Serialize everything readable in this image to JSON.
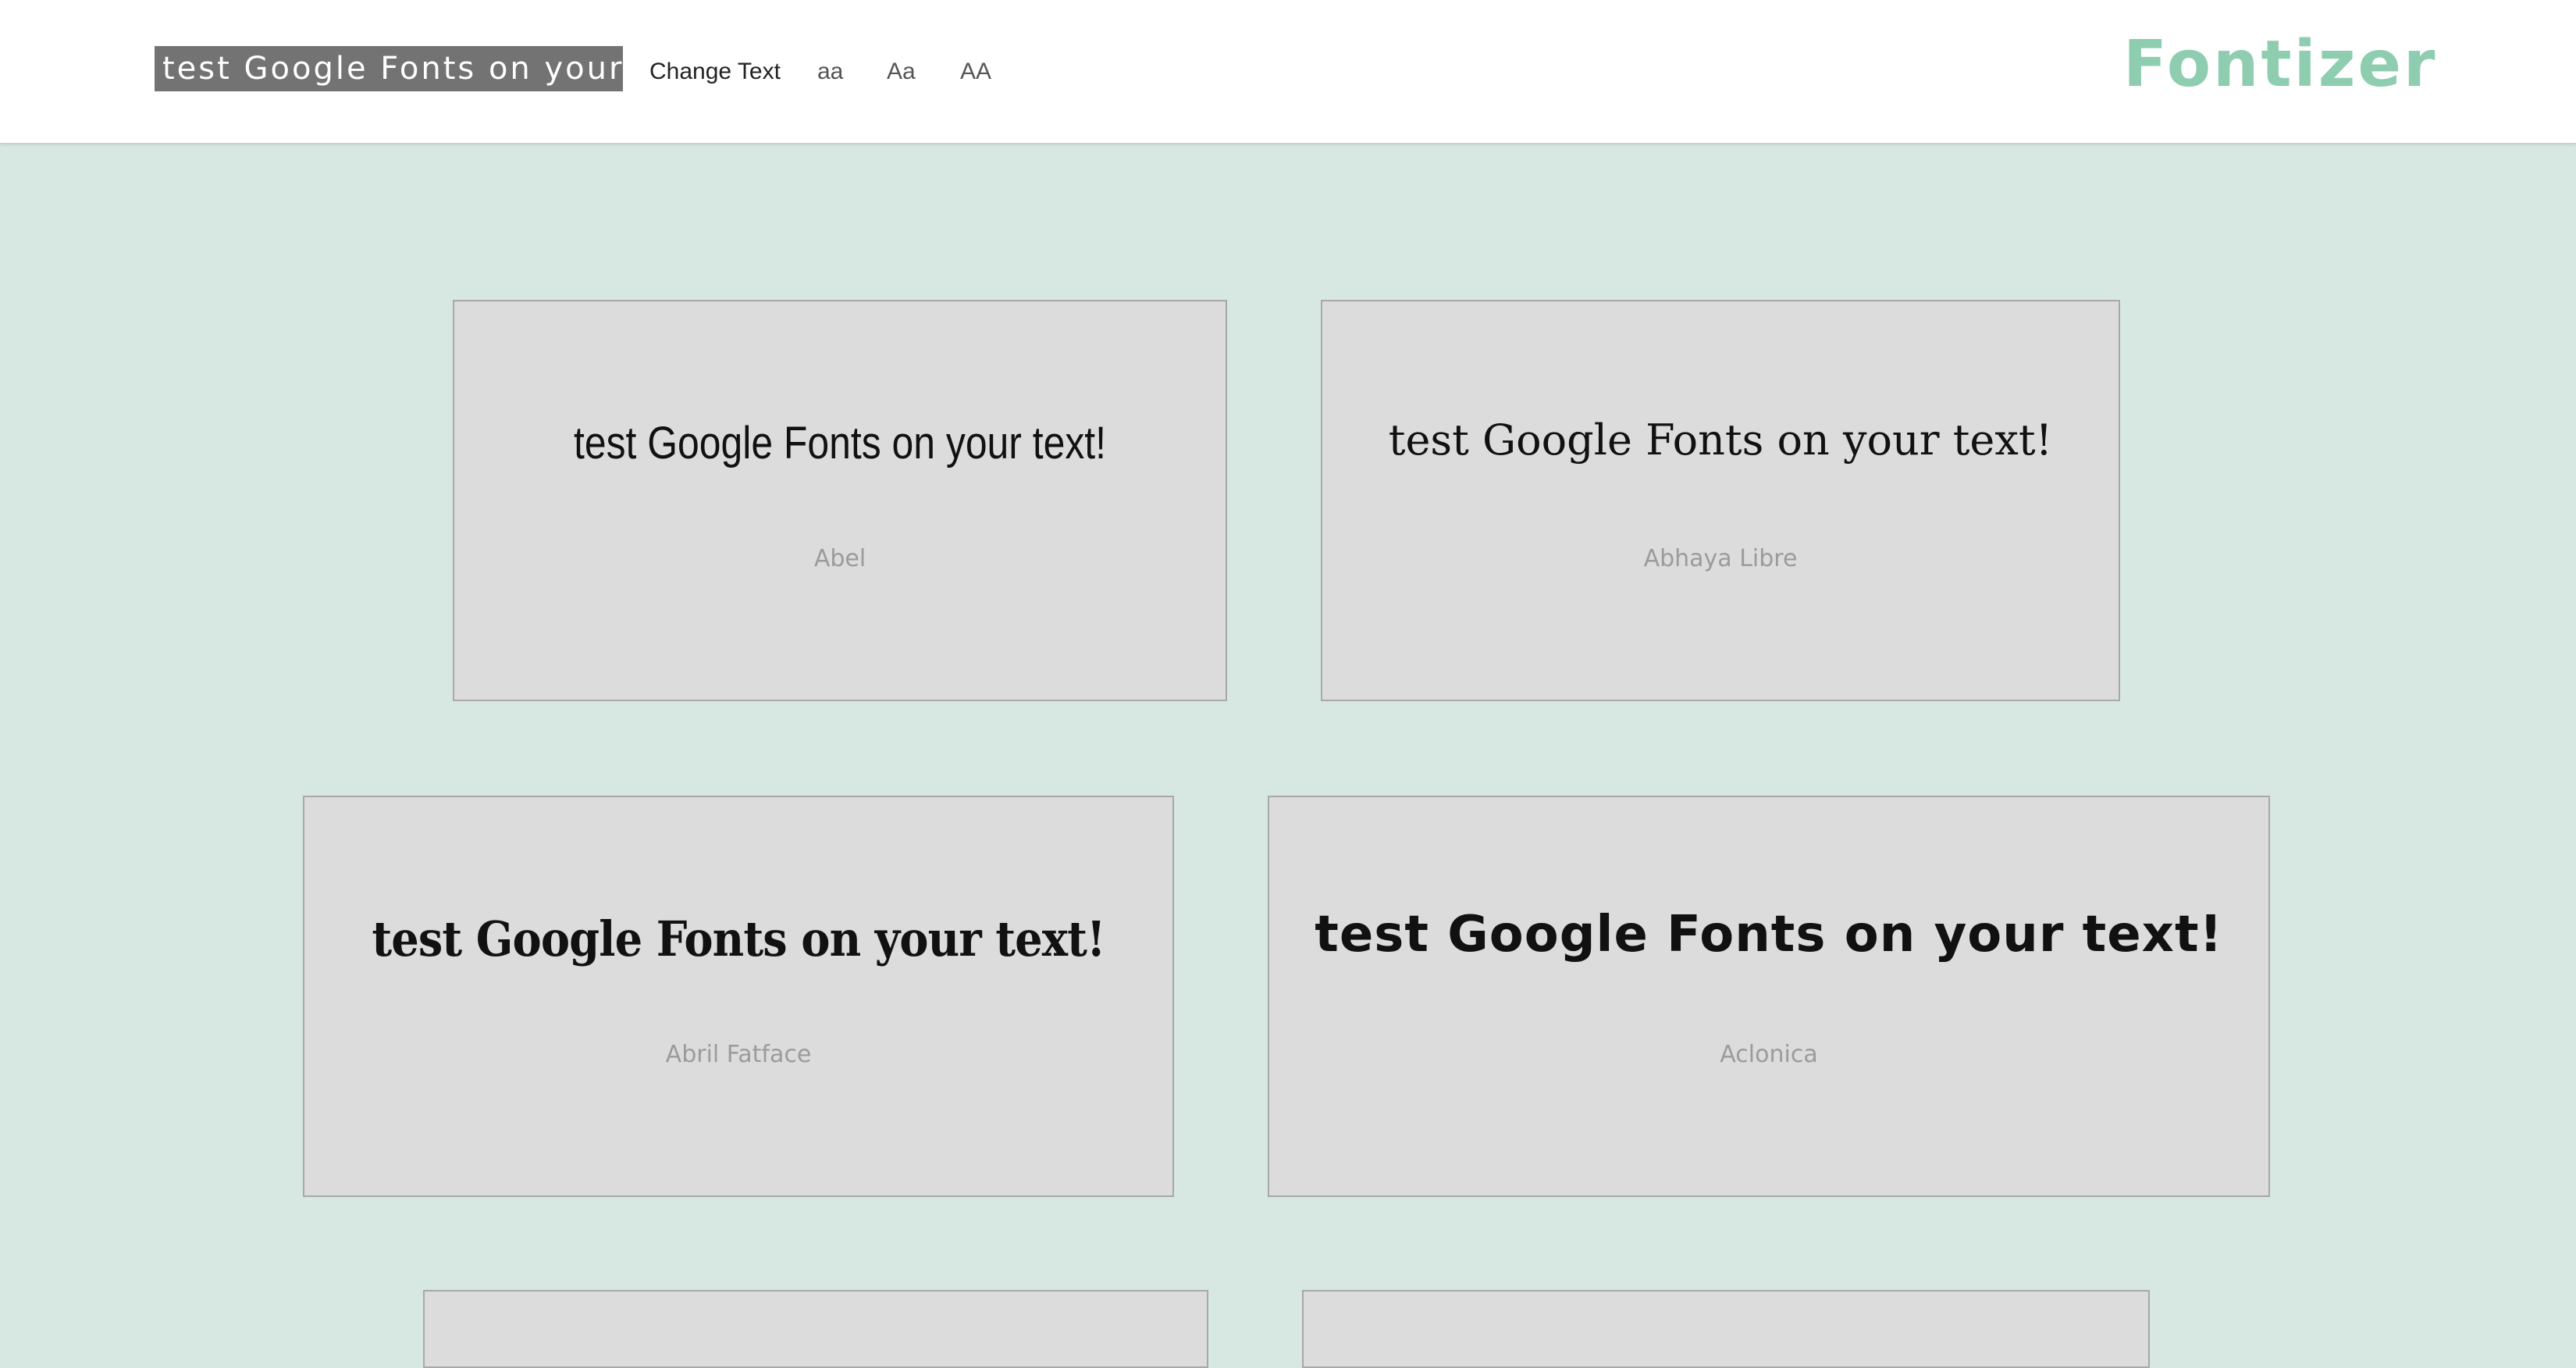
{
  "header": {
    "text_input_value": "test Google Fonts on your text!",
    "change_text_label": "Change Text",
    "case_lower_label": "aa",
    "case_title_label": "Aa",
    "case_upper_label": "AA",
    "logo": "Fontizer"
  },
  "colors": {
    "page_background": "#d7e7e1",
    "header_background": "#ffffff",
    "input_background": "#737373",
    "logo": "#8ecdb0",
    "card_background": "#dcdcdc",
    "card_border": "#a8a8a8",
    "font_name_text": "#9b9b9b"
  },
  "cards": [
    {
      "sample": "test Google Fonts on your text!",
      "font_name": "Abel"
    },
    {
      "sample": "test Google Fonts on your text!",
      "font_name": "Abhaya Libre"
    },
    {
      "sample": "test Google Fonts on your text!",
      "font_name": "Abril Fatface"
    },
    {
      "sample": "test Google Fonts on your text!",
      "font_name": "Aclonica"
    }
  ]
}
